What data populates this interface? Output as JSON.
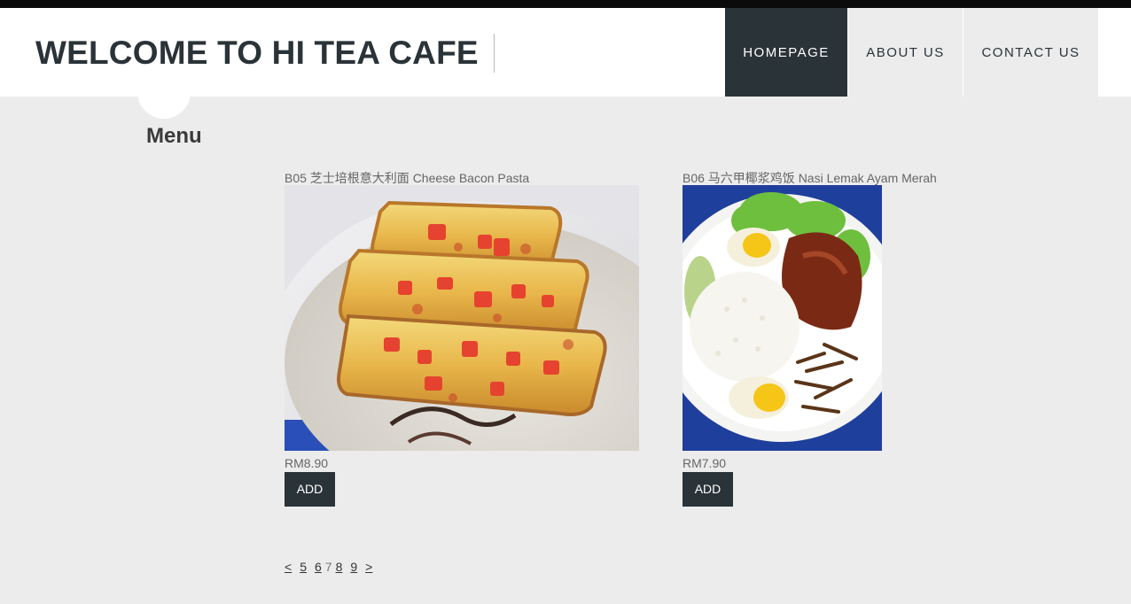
{
  "header": {
    "site_title": "WELCOME TO HI TEA CAFE",
    "nav": [
      {
        "label": "HOMEPAGE",
        "active": true
      },
      {
        "label": "ABOUT US",
        "active": false
      },
      {
        "label": "CONTACT US",
        "active": false
      }
    ]
  },
  "main": {
    "heading": "Menu",
    "items": [
      {
        "name": "B05 芝士培根意大利面 Cheese Bacon Pasta",
        "price": "RM8.90",
        "add_label": "ADD"
      },
      {
        "name": "B06 马六甲椰浆鸡饭 Nasi Lemak Ayam Merah",
        "price": "RM7.90",
        "add_label": "ADD"
      }
    ],
    "pagination": {
      "prev": "<",
      "pages": [
        "5",
        "6",
        "7",
        "8",
        "9"
      ],
      "current": "7",
      "next": ">"
    }
  },
  "colors": {
    "accent": "#2a3338",
    "background": "#ececec"
  }
}
